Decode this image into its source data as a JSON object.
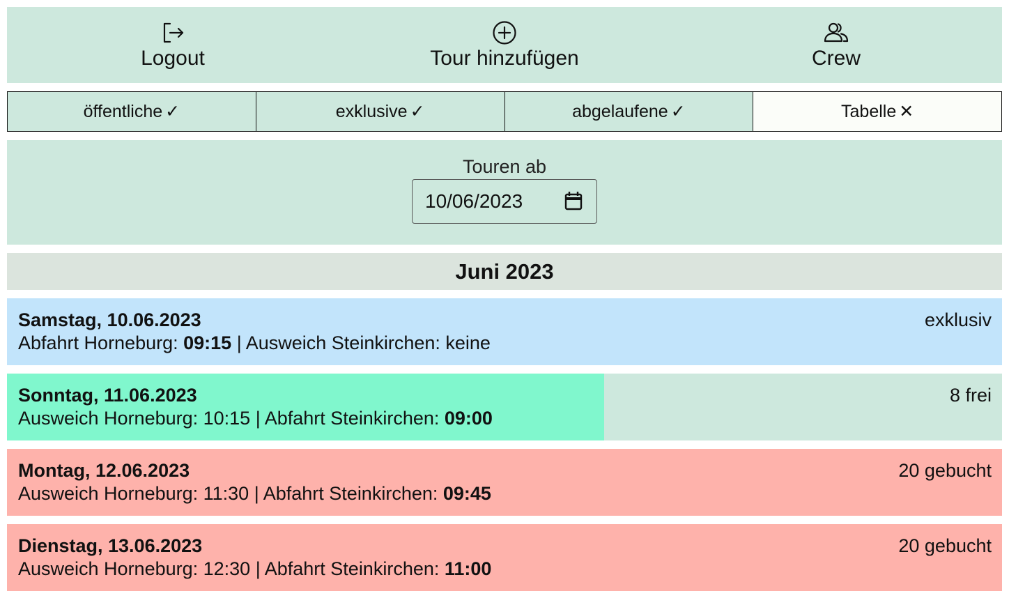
{
  "nav": {
    "logout": "Logout",
    "add_tour": "Tour hinzufügen",
    "crew": "Crew"
  },
  "filters": [
    {
      "label": "öffentliche",
      "mark": "✓"
    },
    {
      "label": "exklusive",
      "mark": "✓"
    },
    {
      "label": "abgelaufene",
      "mark": "✓"
    },
    {
      "label": "Tabelle",
      "mark": "✕"
    }
  ],
  "date_filter": {
    "label": "Touren ab",
    "value": "10/06/2023"
  },
  "month": "Juni 2023",
  "tours": [
    {
      "date": "Samstag, 10.06.2023",
      "part1_label": "Abfahrt Horneburg: ",
      "part1_time": "09:15",
      "sep": " | ",
      "part2_label": "Ausweich Steinkirchen: keine",
      "part2_time": "",
      "status": "exklusiv",
      "color": "#c2e4fb",
      "fill_color": "#c2e4fb",
      "fill_fraction": 1.0
    },
    {
      "date": "Sonntag, 11.06.2023",
      "part1_label": "Ausweich Horneburg: 10:15",
      "part1_time": "",
      "sep": " | ",
      "part2_label": "Abfahrt Steinkirchen: ",
      "part2_time": "09:00",
      "status": "8 frei",
      "color": "#cde8dd",
      "fill_color": "#80f7cd",
      "fill_fraction": 0.6
    },
    {
      "date": "Montag, 12.06.2023",
      "part1_label": "Ausweich Horneburg: 11:30",
      "part1_time": "",
      "sep": " | ",
      "part2_label": "Abfahrt Steinkirchen: ",
      "part2_time": "09:45",
      "status": "20 gebucht",
      "color": "#feb2ab",
      "fill_color": "#feb2ab",
      "fill_fraction": 1.0
    },
    {
      "date": "Dienstag, 13.06.2023",
      "part1_label": "Ausweich Horneburg: 12:30",
      "part1_time": "",
      "sep": " | ",
      "part2_label": "Abfahrt Steinkirchen: ",
      "part2_time": "11:00",
      "status": "20 gebucht",
      "color": "#feb2ab",
      "fill_color": "#feb2ab",
      "fill_fraction": 1.0
    }
  ]
}
